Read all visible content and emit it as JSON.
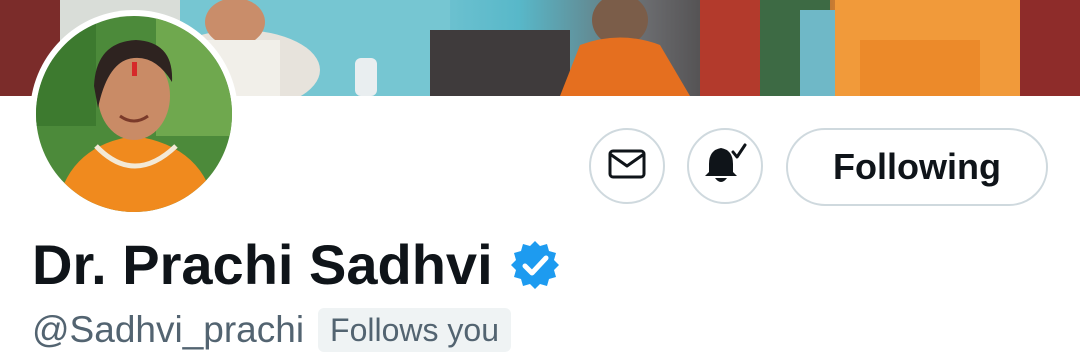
{
  "profile": {
    "display_name": "Dr. Prachi Sadhvi",
    "handle": "@Sadhvi_prachi",
    "follows_you_label": "Follows you",
    "verified": true
  },
  "actions": {
    "message_icon": "envelope-icon",
    "notify_icon": "bell-check-icon",
    "following_label": "Following"
  },
  "colors": {
    "verified_blue": "#1d9bf0",
    "text_primary": "#0f1419",
    "text_secondary": "#536471",
    "button_border": "#cfd9de",
    "badge_bg": "#eff3f4"
  }
}
